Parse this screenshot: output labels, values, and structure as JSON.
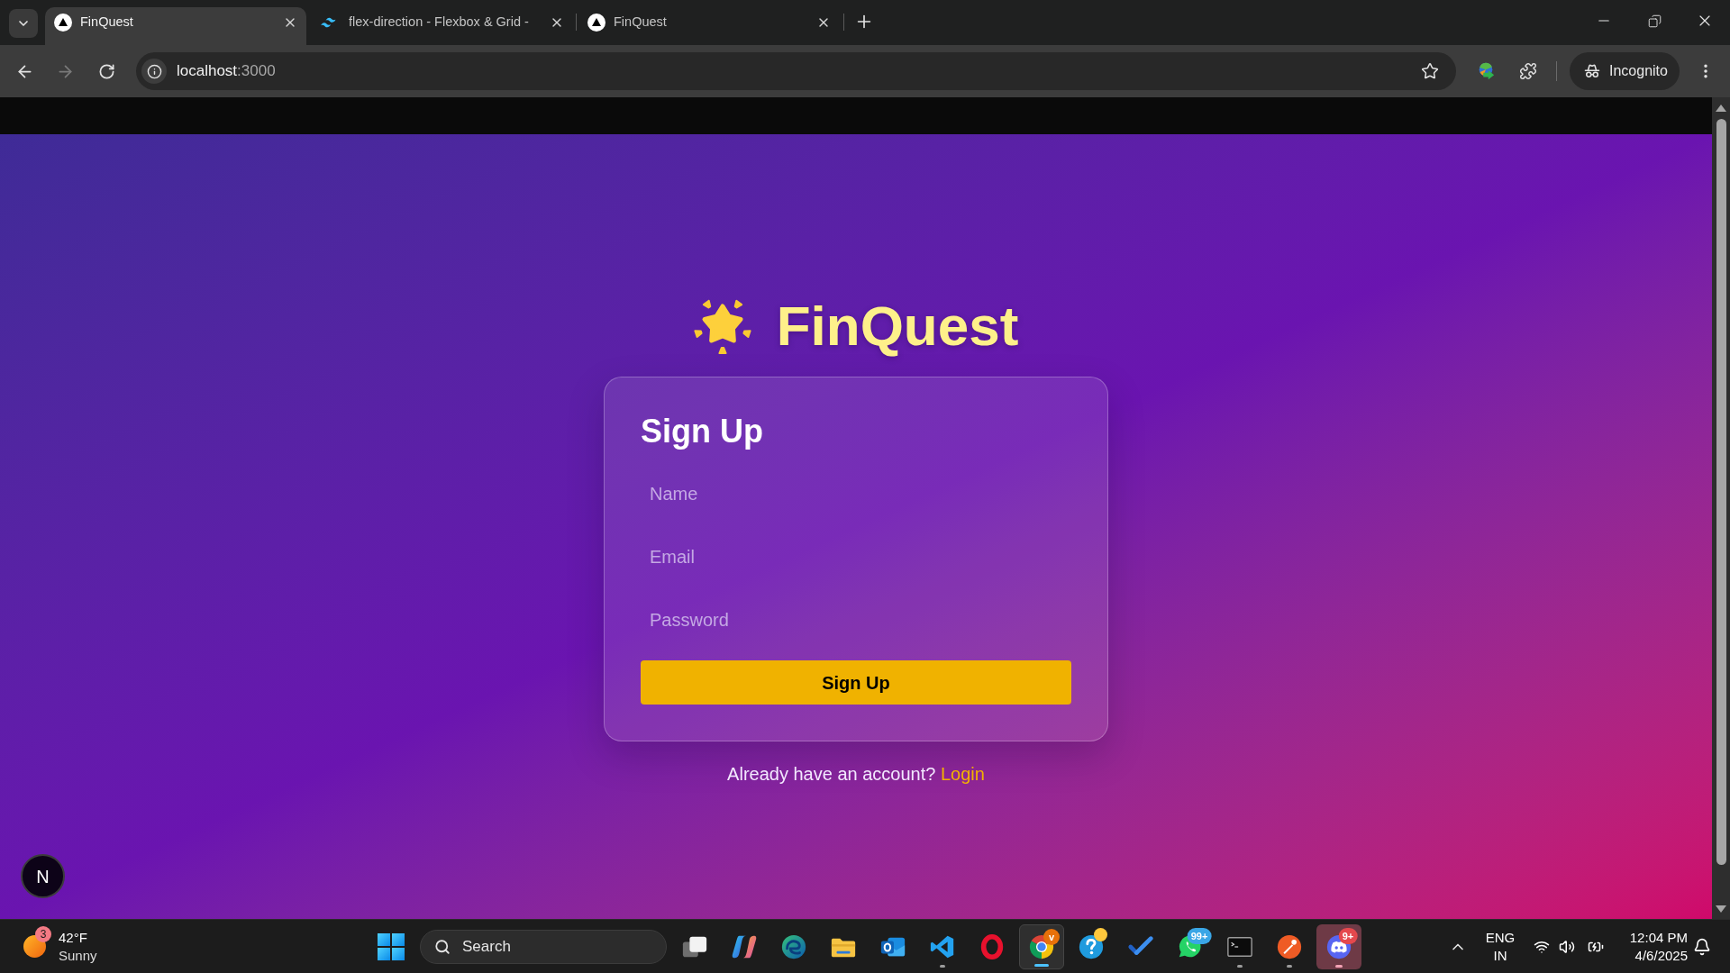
{
  "browser": {
    "tabs": [
      {
        "title": "FinQuest",
        "kind": "triangle",
        "selected": true
      },
      {
        "title": "flex-direction - Flexbox & Grid -",
        "kind": "waves",
        "selected": false
      },
      {
        "title": "FinQuest",
        "kind": "triangle",
        "selected": false
      }
    ],
    "navigation": {
      "back_disabled": false,
      "forward_disabled": true
    },
    "address_bar": {
      "host": "localhost",
      "port": ":3000"
    },
    "profile": {
      "label": "Incognito"
    }
  },
  "page": {
    "brand": {
      "name": "FinQuest"
    },
    "signup_form": {
      "title": "Sign Up",
      "fields": [
        {
          "placeholder": "Name"
        },
        {
          "placeholder": "Email"
        },
        {
          "placeholder": "Password"
        }
      ],
      "submit": "Sign Up"
    },
    "login_prompt": {
      "text": "Already have an account?",
      "link": "Login"
    },
    "dev_indicator": {
      "label": "N"
    }
  },
  "taskbar": {
    "weather": {
      "badge": "3",
      "temperature": "42°F",
      "condition": "Sunny"
    },
    "search": {
      "placeholder": "Search"
    },
    "apps": [
      {
        "kind": "window-stack",
        "running": false,
        "selected": false,
        "flashing": false,
        "dot": false
      },
      {
        "kind": "sparkle-swirl",
        "running": false,
        "selected": false,
        "flashing": false,
        "dot": false
      },
      {
        "kind": "swirl-circle",
        "running": false,
        "selected": false,
        "flashing": false,
        "dot": false
      },
      {
        "kind": "folder",
        "running": false,
        "selected": false,
        "flashing": false,
        "dot": false
      },
      {
        "kind": "mail",
        "running": false,
        "selected": false,
        "flashing": false,
        "dot": false
      },
      {
        "kind": "ribbon",
        "running": true,
        "selected": false,
        "flashing": false,
        "dot": false
      },
      {
        "kind": "ring",
        "running": false,
        "selected": false,
        "flashing": false,
        "dot": false
      },
      {
        "kind": "color-wheel",
        "running": true,
        "selected": true,
        "flashing": false,
        "dot": false,
        "badge": {
          "text": "v",
          "color": "#e8710a"
        }
      },
      {
        "kind": "question",
        "running": false,
        "selected": false,
        "flashing": false,
        "dot": true
      },
      {
        "kind": "check",
        "running": false,
        "selected": false,
        "flashing": false,
        "dot": false
      },
      {
        "kind": "chat-bubble",
        "running": false,
        "selected": false,
        "flashing": false,
        "dot": false,
        "badge": {
          "text": "99+",
          "color": "#3aa6e6"
        }
      },
      {
        "kind": "terminal",
        "running": true,
        "selected": false,
        "flashing": false,
        "dot": false
      },
      {
        "kind": "pen-circle",
        "running": true,
        "selected": false,
        "flashing": false,
        "dot": false
      },
      {
        "kind": "controller",
        "running": true,
        "selected": false,
        "flashing": true,
        "dot": false,
        "badge": {
          "text": "9+",
          "color": "#e5484d"
        }
      }
    ],
    "language": {
      "code": "ENG",
      "region": "IN"
    },
    "clock": {
      "time": "12:04 PM",
      "date": "4/6/2025"
    }
  }
}
